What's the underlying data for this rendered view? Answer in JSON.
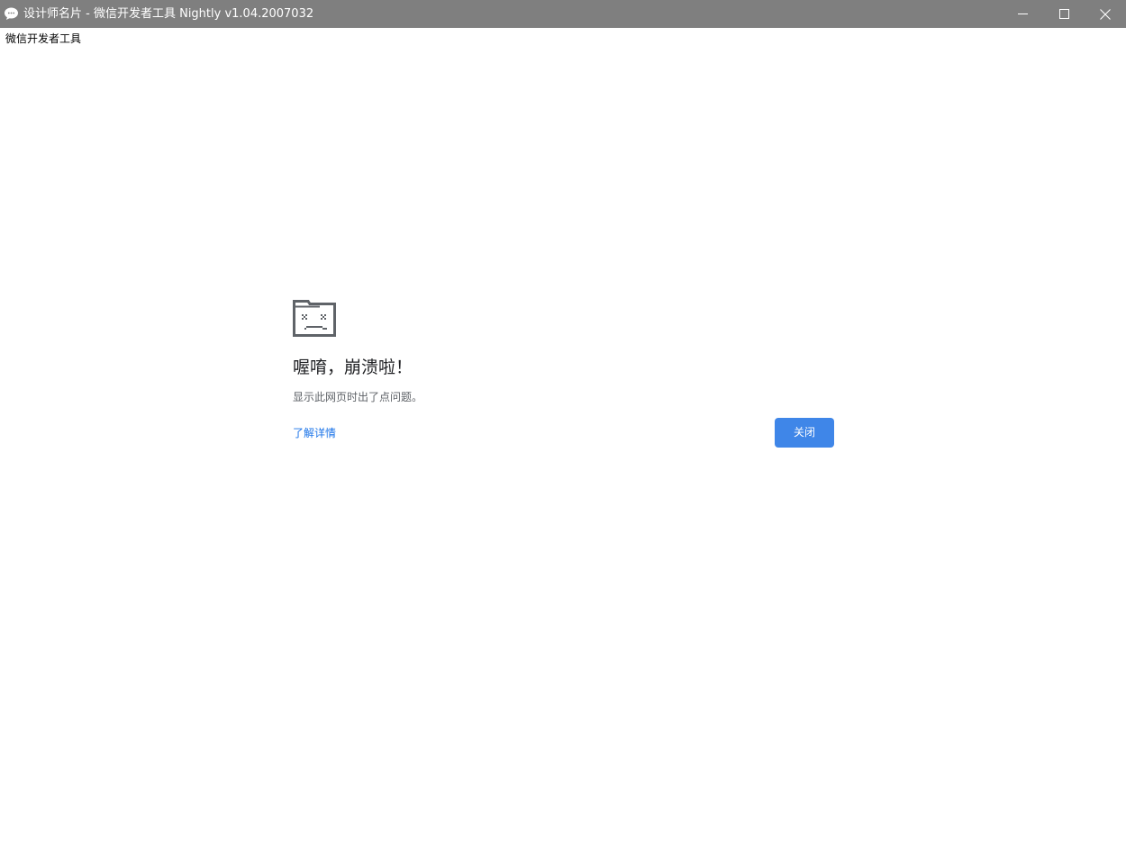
{
  "window": {
    "title": "设计师名片 - 微信开发者工具 Nightly v1.04.2007032",
    "app_icon": "wechat-devtools-icon",
    "controls": {
      "minimize_icon": "minimize-icon",
      "maximize_icon": "maximize-icon",
      "close_icon": "close-icon"
    }
  },
  "menubar": {
    "label": "微信开发者工具"
  },
  "crash_page": {
    "icon": "sad-folder-icon",
    "title": "喔唷，崩溃啦！",
    "message": "显示此网页时出了点问题。",
    "learn_more_label": "了解详情",
    "close_button_label": "关闭"
  },
  "colors": {
    "titlebar_bg": "#7f7f7f",
    "primary_button": "#3f86e8",
    "link": "#1a73e8"
  }
}
